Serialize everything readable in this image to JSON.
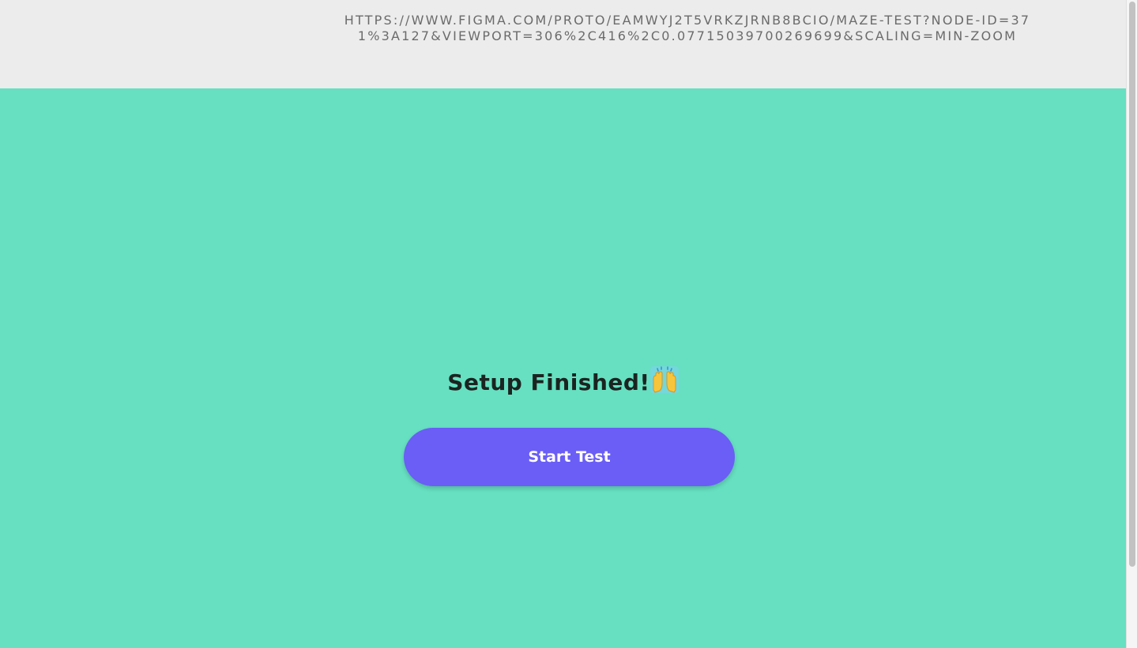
{
  "header": {
    "url": "HTTPS://WWW.FIGMA.COM/PROTO/EAMWYJ2T5VRKZJRNB8BCIO/MAZE-TEST?NODE-ID=371%3A127&VIEWPORT=306%2C416%2C0.07715039700269699&SCALING=MIN-ZOOM"
  },
  "main": {
    "heading": "Setup Finished!",
    "heading_icon": "raising-hands-emoji",
    "button_label": "Start Test"
  },
  "colors": {
    "background": "#66e0c1",
    "button": "#6a5ef6",
    "header_bg": "#ececec"
  }
}
